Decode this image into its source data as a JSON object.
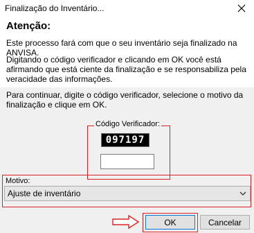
{
  "window": {
    "title": "Finalização do Inventário..."
  },
  "content": {
    "heading": "Atenção:",
    "line1": "Este processo fará com que o seu inventário seja finalizado na ANVISA.",
    "line2": "Digitando o código verificador e clicando em OK você está afirmando que está ciente da finalização e se responsabiliza pela veracidade das informações."
  },
  "form": {
    "instructions": "Para continuar, digite o código verificador, selecione o motivo da finalização e clique em OK.",
    "code_label": "Código Verificador:",
    "captcha": "097197",
    "code_value": "",
    "motivo_label": "Motivo:",
    "motivo_value": "Ajuste de inventário"
  },
  "buttons": {
    "ok": "OK",
    "cancel": "Cancelar"
  },
  "colors": {
    "highlight": "#e02020",
    "focus": "#0078d7"
  },
  "icons": {
    "close": "close-icon",
    "dropdown": "chevron-down-icon",
    "pointer": "arrow-right-icon"
  }
}
